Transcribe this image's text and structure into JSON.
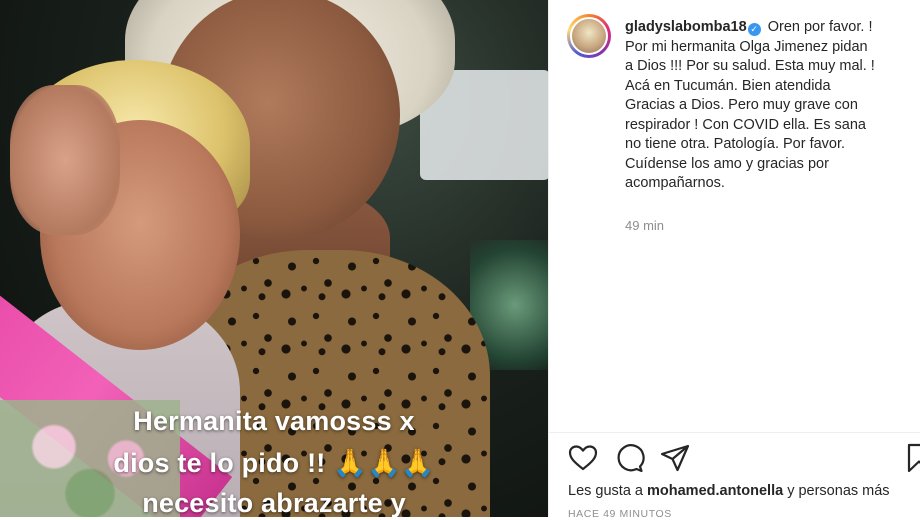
{
  "story": {
    "lines": [
      "Hermanita vamosss x",
      "dios te lo pido !! 🙏🙏🙏",
      "necesito abrazarte y"
    ]
  },
  "post": {
    "username": "gladyslabomba18",
    "caption_lines": [
      "Oren por favor. !",
      "Por mi hermanita Olga Jimenez pidan",
      "a Dios !!! Por su salud. Esta muy mal. !",
      "Acá en Tucumán. Bien atendida",
      "Gracias a Dios. Pero muy grave con",
      "respirador ! Con COVID ella. Es sana",
      "no tiene otra. Patología. Por favor.",
      "Cuídense los amo y gracias por",
      "acompañarnos."
    ],
    "time_ago": "49 min",
    "likes_prefix": "Les gusta a ",
    "likes_user": "mohamed.antonella",
    "likes_suffix": " y personas más",
    "date_label": "HACE 49 MINUTOS"
  },
  "icons": {
    "like": "heart-icon",
    "comment": "comment-icon",
    "share": "paper-plane-icon",
    "save": "bookmark-icon",
    "verified": "verified-badge-icon"
  },
  "colors": {
    "verified_blue": "#3897f0",
    "text": "#262626",
    "muted": "#8e8e8e"
  }
}
